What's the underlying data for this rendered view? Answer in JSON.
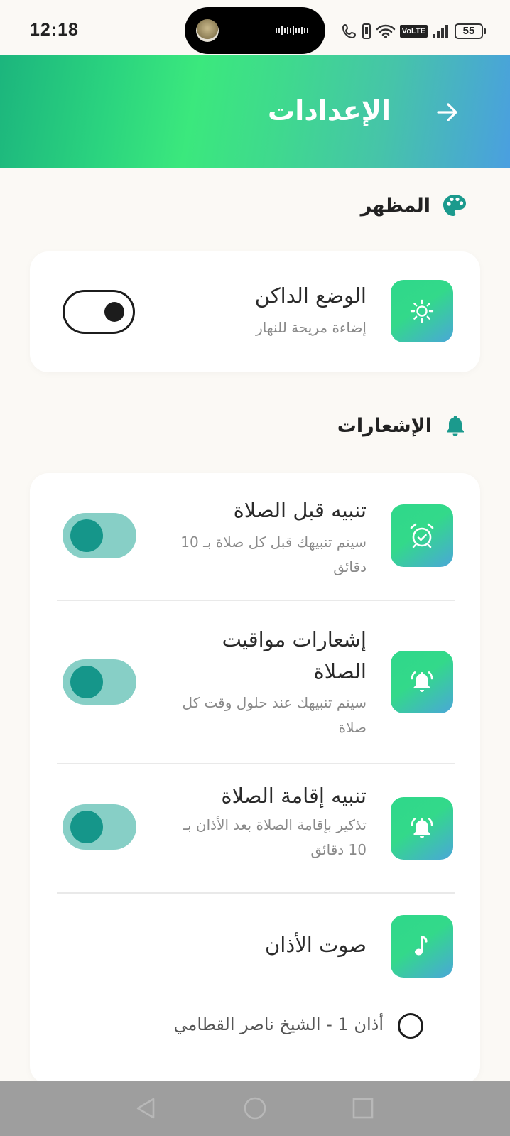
{
  "status_bar": {
    "time": "12:18",
    "network": "VoLTE",
    "battery": "55"
  },
  "header": {
    "title": "الإعدادات",
    "back_icon": "arrow-right-icon"
  },
  "sections": {
    "appearance": {
      "title": "المظهر",
      "icon": "palette-icon"
    },
    "notifications": {
      "title": "الإشعارات",
      "icon": "bell-icon"
    }
  },
  "dark_mode": {
    "title": "الوضع الداكن",
    "subtitle": "إضاءة مريحة للنهار",
    "enabled": false,
    "icon": "sun-icon"
  },
  "notifications": [
    {
      "title": "تنبيه قبل الصلاة",
      "subtitle": "سيتم تنبيهك قبل كل صلاة بـ 10 دقائق",
      "enabled": true,
      "icon": "alarm-check-icon"
    },
    {
      "title": "إشعارات مواقيت الصلاة",
      "subtitle": "سيتم تنبيهك عند حلول وقت كل صلاة",
      "enabled": true,
      "icon": "bell-ringing-icon"
    },
    {
      "title": "تنبيه إقامة الصلاة",
      "subtitle": "تذكير بإقامة الصلاة بعد الأذان بـ 10 دقائق",
      "enabled": true,
      "icon": "bell-ringing-icon"
    }
  ],
  "adhan_sound": {
    "title": "صوت الأذان",
    "icon": "music-note-icon",
    "options": [
      {
        "label": "أذان 1 - الشيخ ناصر القطامي",
        "selected": false
      }
    ]
  },
  "colors": {
    "accent": "#15968a",
    "toggle_track": "#87cfc6",
    "tile_start": "#2fd88a",
    "tile_end": "#4aa7d8"
  }
}
